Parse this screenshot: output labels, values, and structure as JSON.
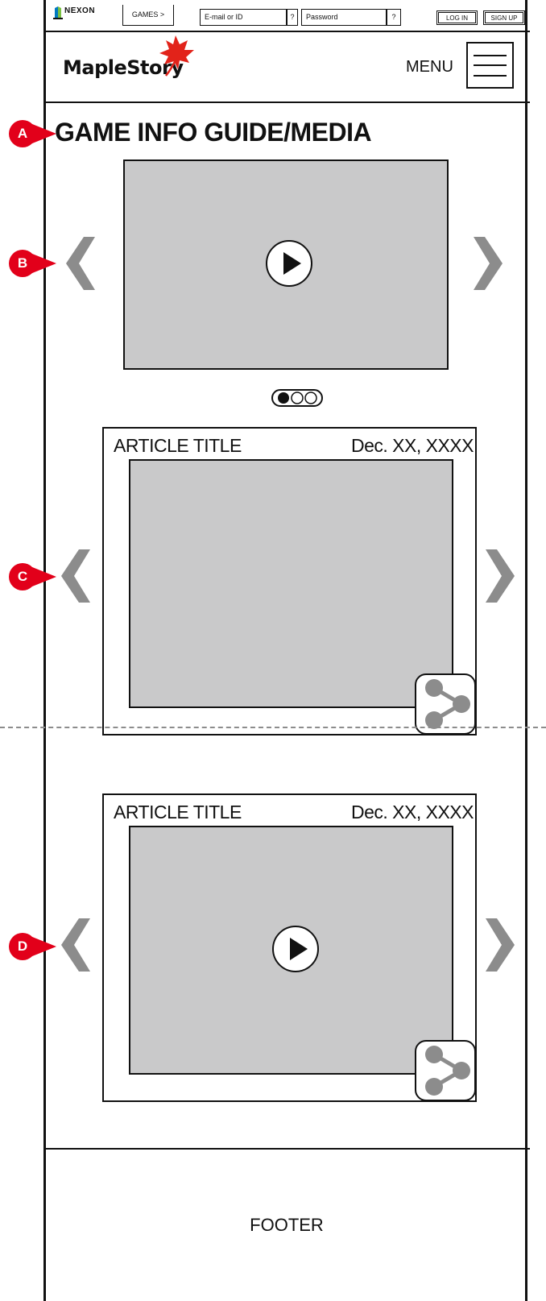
{
  "topbar": {
    "nexon_label": "NEXON",
    "games_label": "GAMES >",
    "email_placeholder": "E-mail or ID",
    "help1": "?",
    "password_placeholder": "Password",
    "help2": "?",
    "login_label": "LOG IN",
    "signup_label": "SIGN UP"
  },
  "header": {
    "logo_text": "MapleStory",
    "menu_label": "MENU"
  },
  "page_title": "GAME INFO GUIDE/MEDIA",
  "markers": {
    "a": "A",
    "b": "B",
    "c": "C",
    "d": "D"
  },
  "articles": [
    {
      "title": "ARTICLE TITLE",
      "date": "Dec. XX, XXXX"
    },
    {
      "title": "ARTICLE TITLE",
      "date": "Dec. XX, XXXX"
    }
  ],
  "footer": {
    "label": "FOOTER"
  },
  "colors": {
    "marker": "#e2001a",
    "media": "#c9c9ca",
    "arrow": "#8c8c8c",
    "share": "#8c8c8c"
  }
}
